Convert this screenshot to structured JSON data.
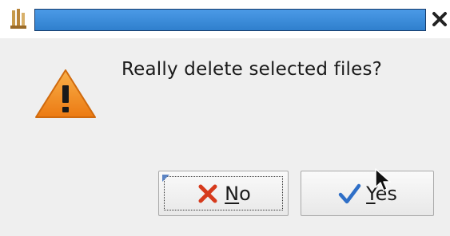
{
  "dialog": {
    "message": "Really delete selected files?"
  },
  "buttons": {
    "no": {
      "mnemonic": "N",
      "rest": "o",
      "icon": "x-mark-icon"
    },
    "yes": {
      "mnemonic": "Y",
      "rest": "es",
      "icon": "checkmark-icon"
    }
  },
  "titlebar": {
    "app_icon": "app-icon",
    "close_icon": "close-icon",
    "accent": "#3c8ad9"
  },
  "icons": {
    "warning": "warning-triangle-icon"
  },
  "colors": {
    "warning_fill": "#f28a1c",
    "no_icon": "#d63a1c",
    "yes_icon": "#2f6fc7"
  }
}
